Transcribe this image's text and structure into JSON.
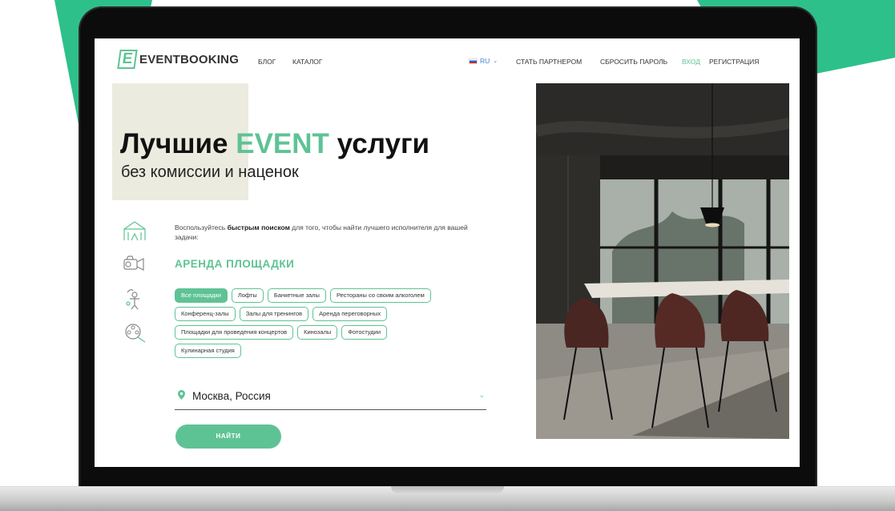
{
  "logo": {
    "mark": "E",
    "name": "EVENTBOOKING"
  },
  "nav": {
    "left": [
      "БЛОГ",
      "КАТАЛОГ"
    ],
    "lang": "RU",
    "right": [
      "СТАТЬ ПАРТНЕРОМ",
      "СБРОСИТЬ ПАРОЛЬ",
      "ВХОД",
      "РЕГИСТРАЦИЯ"
    ]
  },
  "hero": {
    "title_part1": "Лучшие",
    "title_accent": "EVENT",
    "title_part2": "услуги",
    "subtitle": "без комиссии и наценок"
  },
  "search": {
    "intro_before": "Воспользуйтесь",
    "intro_bold": "быстрым поиском",
    "intro_after": "для того, чтобы найти лучшего исполнителя для вашей задачи:",
    "section_title": "АРЕНДА ПЛОЩАДКИ",
    "tags": [
      [
        "Все площадки",
        "Лофты",
        "Банкетные залы",
        "Рестораны со своим алкоголем"
      ],
      [
        "Конференц-залы",
        "Залы для тренингов",
        "Аренда переговорных"
      ],
      [
        "Площадки для проведения концертов",
        "Кинозалы",
        "Фотостудии"
      ],
      [
        "Кулинарная студия"
      ]
    ],
    "active_tag": "Все площадки",
    "location": "Москва, Россия",
    "button": "НАЙТИ"
  },
  "colors": {
    "accent": "#5ec394",
    "beige": "#ecebdf",
    "background_green": "#2ec08a"
  },
  "icons": [
    "tent-icon",
    "camera-icon",
    "juggler-icon",
    "film-reel-icon",
    "map-pin-icon",
    "chevron-down-icon"
  ]
}
